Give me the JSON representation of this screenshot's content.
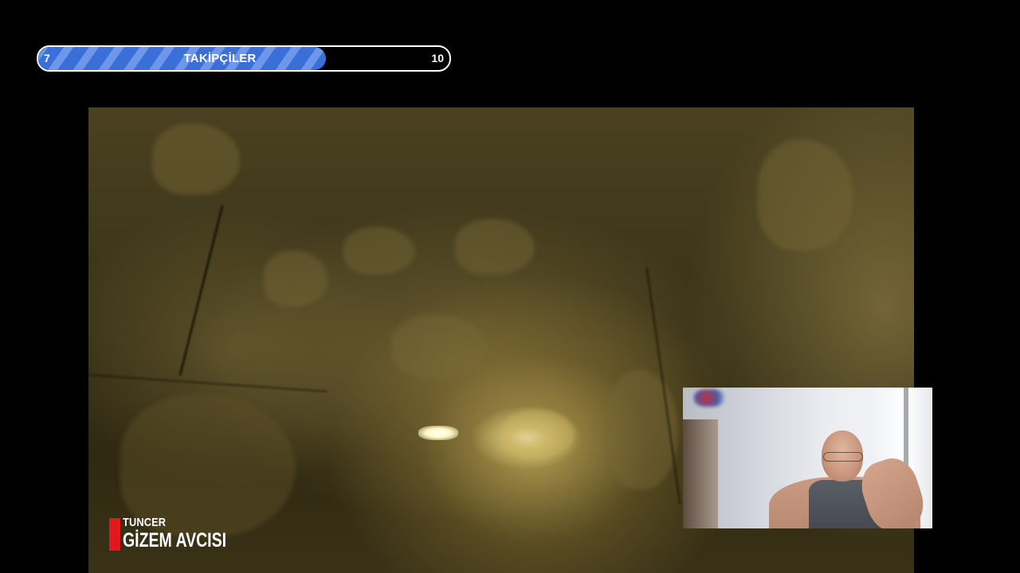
{
  "follower_goal": {
    "current": "7",
    "target": "10",
    "label": "TAKİPÇİLER",
    "progress_fraction": 0.7,
    "fill_color": "#3a6fd8",
    "stripe_color": "#6d97ea"
  },
  "channel_logo": {
    "top_text": "TUNCER",
    "main_text": "GİZEM AVCISI",
    "accent_color": "#e1181e"
  },
  "scene": {
    "video_subject": "cave-tunnel",
    "webcam": "presenter-webcam"
  }
}
